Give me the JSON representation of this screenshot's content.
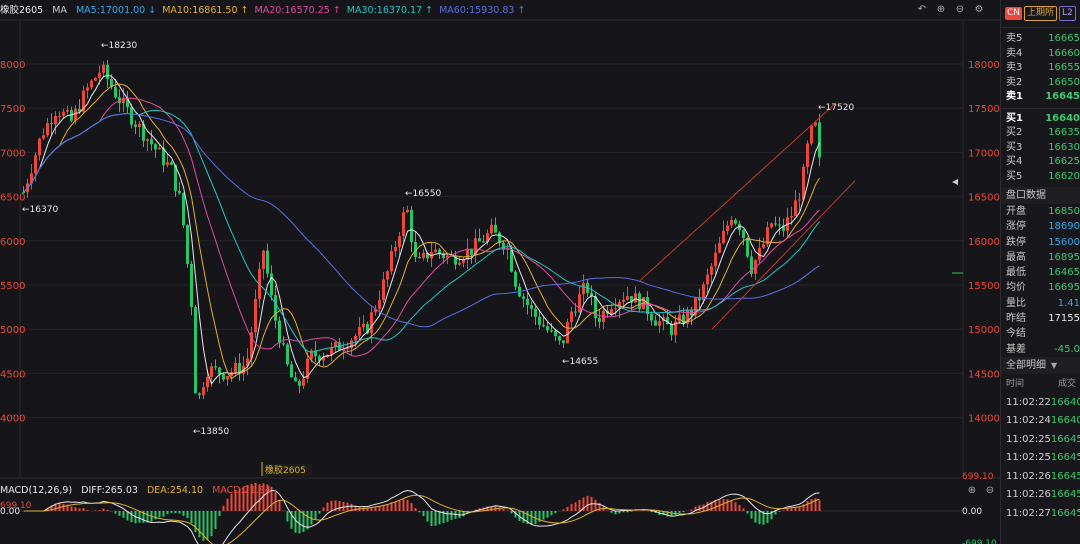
{
  "chart": {
    "symbol": "橡胶2605",
    "ma_label": "MA",
    "ma_items": [
      {
        "label": "MA5:17001.00",
        "color": "#36a8e8"
      },
      {
        "label": "MA10:16861.50",
        "color": "#e0b030"
      },
      {
        "label": "MA20:16570.25",
        "color": "#e04aa0"
      },
      {
        "label": "MA30:16370.17",
        "color": "#22c6c6"
      },
      {
        "label": "MA60:15930.83",
        "color": "#5a6ee0"
      }
    ],
    "right_axis_ticks": [
      "18000",
      "17500",
      "17000",
      "16500",
      "16000",
      "15500",
      "15000",
      "14500",
      "14000"
    ],
    "left_axis_ticks": [
      "8000",
      "7500",
      "7000",
      "6500",
      "6000",
      "5500",
      "5000",
      "4500",
      "4000"
    ],
    "annotations": {
      "high_label": "18230",
      "left_low_label": "16370",
      "mid_high_label": "16550",
      "low_label": "13850",
      "second_low_label": "14655",
      "recent_high_label": "17520",
      "contract_tag": "橡胶2605"
    },
    "tools": [
      "undo-icon",
      "zoom-in-icon",
      "zoom-out-icon",
      "settings-icon"
    ]
  },
  "macd": {
    "title": "MACD(12,26,9)",
    "diff": "DIFF:265.03",
    "dea": "DEA:254.10",
    "macd": "MACD:21.84",
    "left_top": "699.10",
    "left_zero": "0.00",
    "right_top": "699.10",
    "right_zero": "0.00",
    "right_bottom": "-699.10",
    "tools": [
      "zoom-in-icon",
      "zoom-out-icon",
      "settings-icon"
    ]
  },
  "panel": {
    "tags": [
      "CN",
      "上期所",
      "L2"
    ],
    "asks": [
      {
        "label": "卖5",
        "price": "16665"
      },
      {
        "label": "卖4",
        "price": "16660"
      },
      {
        "label": "卖3",
        "price": "16655"
      },
      {
        "label": "卖2",
        "price": "16650"
      },
      {
        "label": "卖1",
        "price": "16645"
      }
    ],
    "bids": [
      {
        "label": "买1",
        "price": "16640"
      },
      {
        "label": "买2",
        "price": "16635"
      },
      {
        "label": "买3",
        "price": "16630"
      },
      {
        "label": "买4",
        "price": "16625"
      },
      {
        "label": "买5",
        "price": "16620"
      }
    ],
    "quote_title": "盘口数据",
    "stats": [
      {
        "label": "开盘",
        "value": "16850",
        "tone": "green"
      },
      {
        "label": "涨停",
        "value": "18690",
        "tone": "cyan"
      },
      {
        "label": "跌停",
        "value": "15600",
        "tone": "cyan"
      },
      {
        "label": "最高",
        "value": "16895",
        "tone": "green"
      },
      {
        "label": "最低",
        "value": "16465",
        "tone": "green"
      },
      {
        "label": "均价",
        "value": "16695",
        "tone": "green"
      },
      {
        "label": "量比",
        "value": "1.41",
        "tone": "cyan"
      },
      {
        "label": "昨结",
        "value": "17155",
        "tone": "white"
      },
      {
        "label": "今结",
        "value": "",
        "tone": "white"
      },
      {
        "label": "基差",
        "value": "-45.0",
        "tone": "green"
      }
    ],
    "ticks_title": "全部明细",
    "ticks_head": {
      "time": "时间",
      "price": "成交"
    },
    "ticks": [
      {
        "time": "11:02:22",
        "price": "16640"
      },
      {
        "time": "11:02:24",
        "price": "16640"
      },
      {
        "time": "11:02:25",
        "price": "16645"
      },
      {
        "time": "11:02:25",
        "price": "16645"
      },
      {
        "time": "11:02:26",
        "price": "16645"
      },
      {
        "time": "11:02:26",
        "price": "16645"
      },
      {
        "time": "11:02:27",
        "price": "16645"
      }
    ]
  }
}
